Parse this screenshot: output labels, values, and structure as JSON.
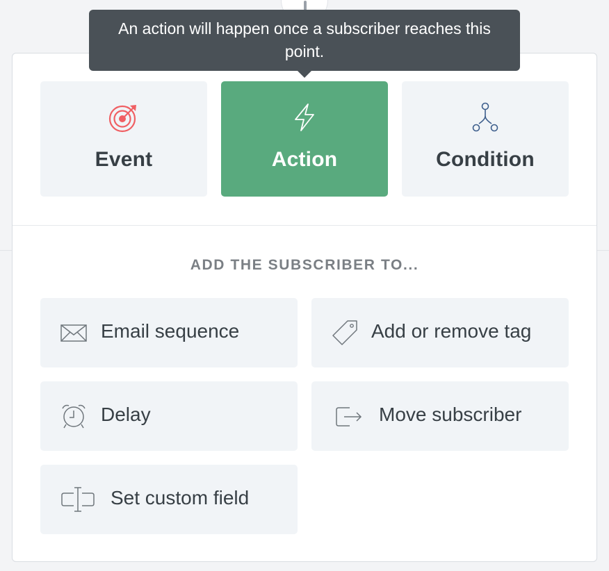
{
  "tooltip": {
    "text": "An action will happen once a subscriber reaches this point."
  },
  "node_types": [
    {
      "label": "Event",
      "icon": "target-icon",
      "active": false
    },
    {
      "label": "Action",
      "icon": "lightning-bolt-icon",
      "active": true
    },
    {
      "label": "Condition",
      "icon": "branch-icon",
      "active": false
    }
  ],
  "section": {
    "heading": "ADD THE SUBSCRIBER TO..."
  },
  "options": [
    {
      "label": "Email sequence",
      "icon": "envelope-icon"
    },
    {
      "label": "Add or remove tag",
      "icon": "tag-icon"
    },
    {
      "label": "Delay",
      "icon": "alarm-clock-icon"
    },
    {
      "label": "Move subscriber",
      "icon": "exit-arrow-icon"
    },
    {
      "label": "Set custom field",
      "icon": "text-field-icon"
    }
  ],
  "colors": {
    "active_card": "#59aa7e",
    "card_background": "#f1f4f7",
    "event_icon": "#f05f63",
    "condition_icon": "#3d5e8c",
    "tooltip_background": "#4a5157"
  }
}
